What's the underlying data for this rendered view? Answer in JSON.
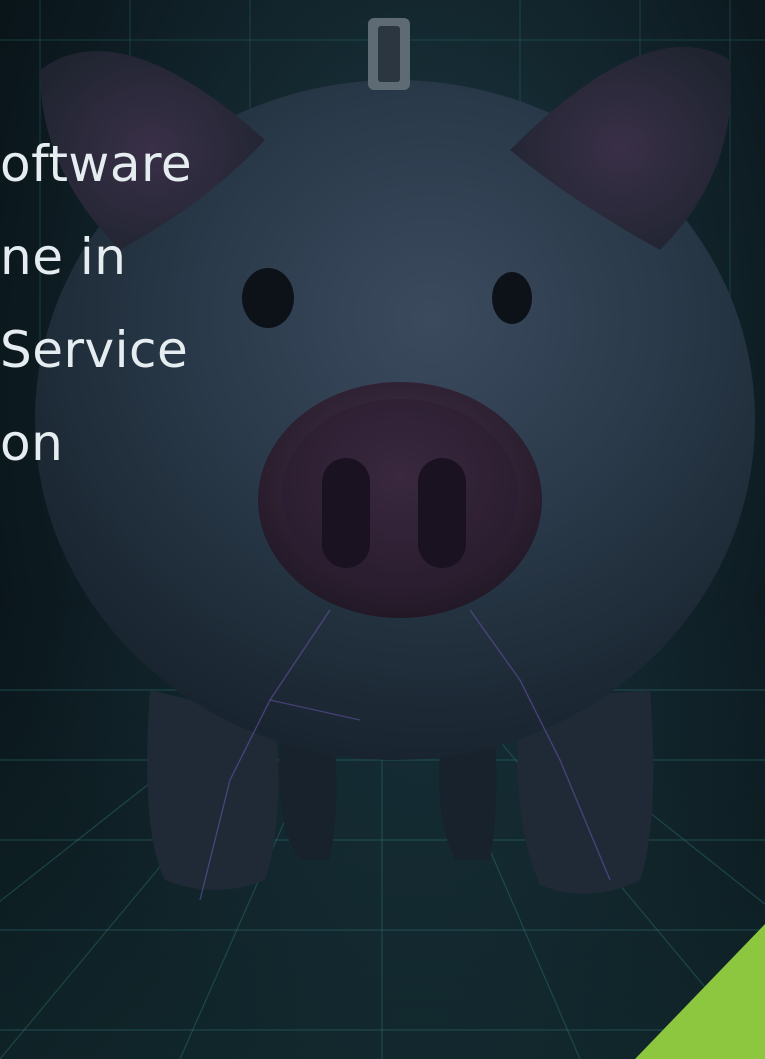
{
  "headline": {
    "line1": "oftware",
    "line2": "ne in",
    "line3": "Service",
    "line4": "on"
  },
  "illustration": {
    "subject": "piggy-bank"
  },
  "colors": {
    "background": "#0f2028",
    "grid": "#2f6e73",
    "pig_body": "#2a3a4a",
    "pig_shadow": "#1a2430",
    "snout": "#3a2a40",
    "headline_text": "#e6edf0",
    "accent": "#8dc63f"
  }
}
